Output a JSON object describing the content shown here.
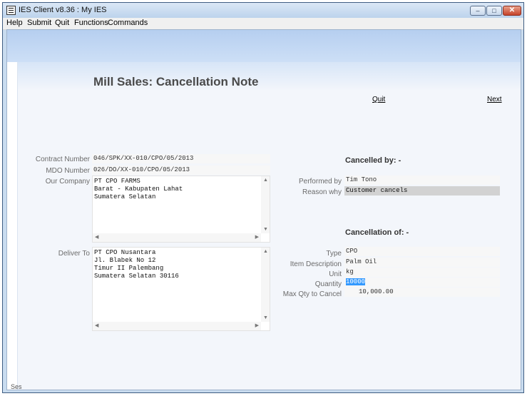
{
  "window": {
    "title": "IES Client v8.36 : My IES"
  },
  "menu": {
    "items": [
      "Help",
      "Submit",
      "Quit",
      "Functions",
      "Commands"
    ]
  },
  "page": {
    "title": "Mill Sales: Cancellation Note",
    "quit_label": "Quit",
    "next_label": "Next"
  },
  "left": {
    "contract_number": {
      "label": "Contract Number",
      "value": "046/SPK/XX-010/CPO/05/2013"
    },
    "mdo_number": {
      "label": "MDO Number",
      "value": "026/DO/XX-010/CPO/05/2013"
    },
    "our_company": {
      "label": "Our Company",
      "value": "PT CPO FARMS\nBarat - Kabupaten Lahat\nSumatera Selatan"
    },
    "deliver_to": {
      "label": "Deliver To",
      "value": "PT CPO Nusantara\nJl. Blabek No 12\nTimur II Palembang\nSumatera Selatan 30116"
    }
  },
  "cancelled_by": {
    "title": "Cancelled by: -",
    "performed_by": {
      "label": "Performed by",
      "value": "Tim Tono"
    },
    "reason_why": {
      "label": "Reason why",
      "value": "Customer cancels"
    }
  },
  "cancellation_of": {
    "title": "Cancellation of: -",
    "type": {
      "label": "Type",
      "value": "CPO"
    },
    "item_description": {
      "label": "Item Description",
      "value": "Palm Oil"
    },
    "unit": {
      "label": "Unit",
      "value": "kg"
    },
    "quantity": {
      "label": "Quantity",
      "value": "10000"
    },
    "max_qty": {
      "label": "Max Qty to Cancel",
      "value": "10,000.00"
    }
  },
  "session": {
    "label": "Ses",
    "icon_glyph": "E"
  }
}
